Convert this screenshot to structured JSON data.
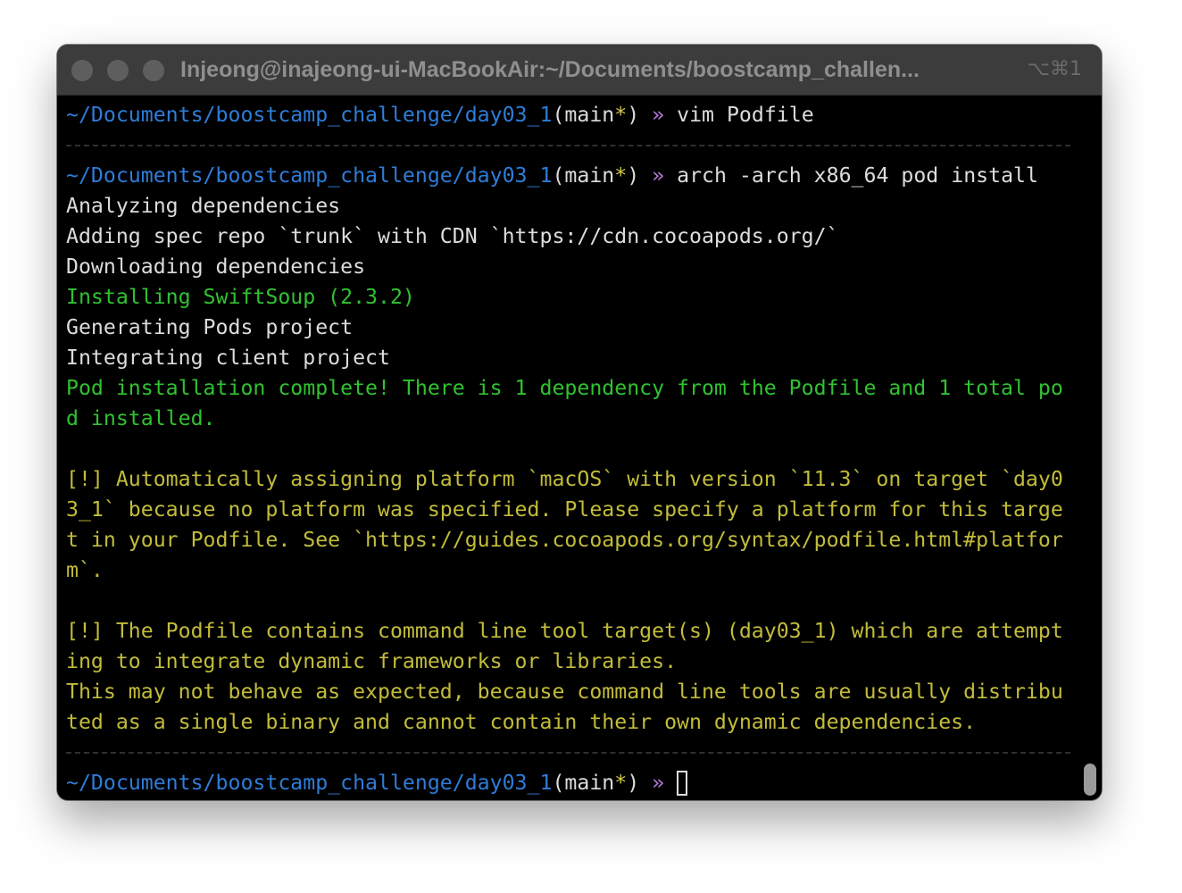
{
  "window": {
    "title": "Injeong@inajeong-ui-MacBookAir:~/Documents/boostcamp_challen...",
    "shortcut": "⌥⌘1"
  },
  "prompt": {
    "path": "~/Documents/boostcamp_challenge/day03_1",
    "open_paren": "(",
    "branch": "main",
    "star": "*",
    "close_paren": ")",
    "arrow": "»"
  },
  "terminal": {
    "cmd1": "vim Podfile",
    "cmd2": "arch -arch x86_64 pod install",
    "out": [
      "Analyzing dependencies",
      "Adding spec repo `trunk` with CDN `https://cdn.cocoapods.org/`",
      "Downloading dependencies"
    ],
    "installing": "Installing SwiftSoup (2.3.2)",
    "out2": [
      "Generating Pods project",
      "Integrating client project"
    ],
    "complete": [
      "Pod installation complete! There is 1 dependency from the Podfile and 1 total po",
      "d installed."
    ],
    "warning1": [
      "[!] Automatically assigning platform `macOS` with version `11.3` on target `day0",
      "3_1` because no platform was specified. Please specify a platform for this targe",
      "t in your Podfile. See `https://guides.cocoapods.org/syntax/podfile.html#platfor",
      "m`."
    ],
    "warning2": [
      "[!] The Podfile contains command line tool target(s) (day03_1) which are attempt",
      "ing to integrate dynamic frameworks or libraries.",
      "This may not behave as expected, because command line tools are usually distribu",
      "ted as a single binary and cannot contain their own dynamic dependencies."
    ]
  },
  "colors": {
    "path": "#2f7cd8",
    "success": "#30c230",
    "warning": "#c2bc3a",
    "arrow": "#b67ad8",
    "star": "#d4c84a"
  },
  "icons": [
    "close-light",
    "minimize-light",
    "zoom-light",
    "cursor-block"
  ]
}
